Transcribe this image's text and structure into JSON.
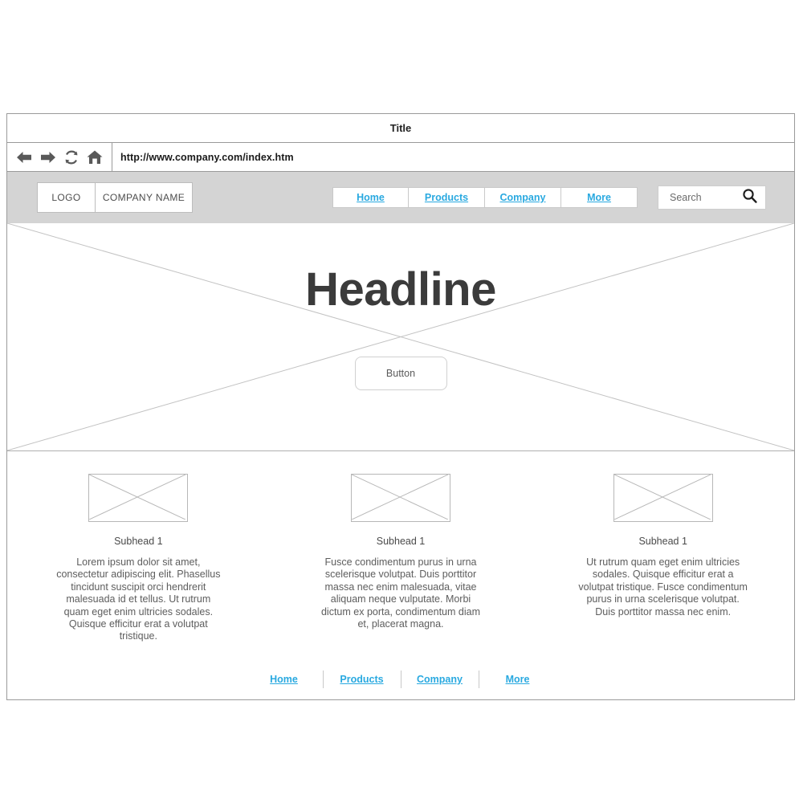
{
  "browser": {
    "title": "Title",
    "url": "http://www.company.com/index.htm",
    "icons": {
      "back": "back-arrow-icon",
      "forward": "forward-arrow-icon",
      "reload": "reload-icon",
      "home": "home-icon"
    }
  },
  "header": {
    "logo_label": "LOGO",
    "company_name": "COMPANY NAME",
    "nav": [
      {
        "label": "Home"
      },
      {
        "label": "Products"
      },
      {
        "label": "Company"
      },
      {
        "label": "More"
      }
    ],
    "search": {
      "placeholder": "Search",
      "icon": "search-icon"
    },
    "background_color": "#d4d4d4"
  },
  "hero": {
    "headline": "Headline",
    "button_label": "Button"
  },
  "columns": [
    {
      "subhead": "Subhead 1",
      "body": "Lorem ipsum dolor sit amet, consectetur adipiscing elit. Phasellus tincidunt suscipit orci hendrerit malesuada id et tellus. Ut rutrum quam eget enim ultricies sodales. Quisque efficitur erat a volutpat tristique."
    },
    {
      "subhead": "Subhead 1",
      "body": "Fusce condimentum purus in urna scelerisque volutpat. Duis porttitor massa nec enim malesuada, vitae aliquam neque vulputate. Morbi dictum ex porta, condimentum diam et, placerat magna."
    },
    {
      "subhead": "Subhead 1",
      "body": "Ut rutrum quam eget enim ultricies sodales. Quisque efficitur erat a volutpat tristique. Fusce condimentum purus in urna scelerisque volutpat. Duis porttitor massa nec enim."
    }
  ],
  "footer": {
    "links": [
      {
        "label": "Home"
      },
      {
        "label": "Products"
      },
      {
        "label": "Company"
      },
      {
        "label": "More"
      }
    ]
  },
  "colors": {
    "link": "#29a9e0",
    "header_band": "#d4d4d4",
    "frame_border": "#9a9a9a",
    "headline_text": "#3b3b3b"
  }
}
